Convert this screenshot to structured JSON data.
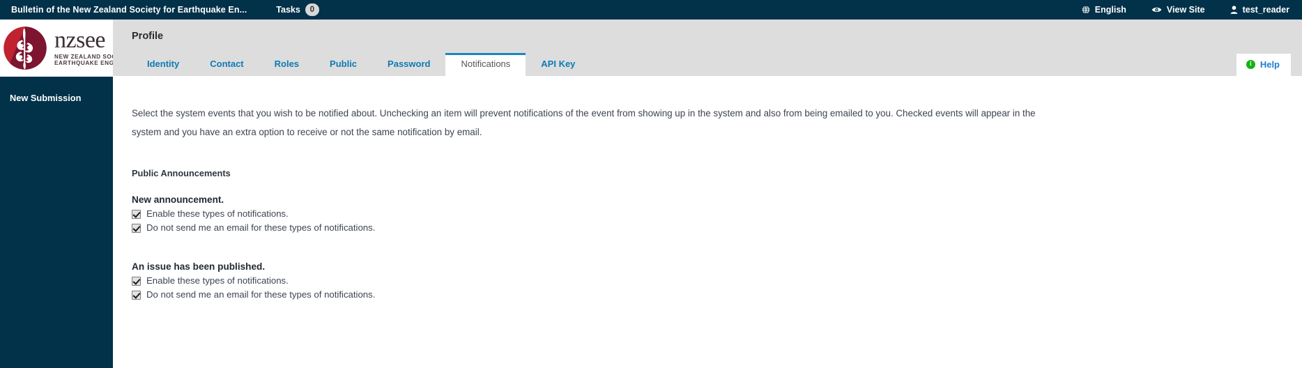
{
  "topbar": {
    "brand_title": "Bulletin of the New Zealand Society for Earthquake En...",
    "tasks_label": "Tasks",
    "tasks_count": "0",
    "language": "English",
    "language_icon": "globe-icon",
    "view_site": "View Site",
    "view_site_icon": "eye-icon",
    "user": "test_reader",
    "user_icon": "user-icon",
    "background_color": "#02314a"
  },
  "sidebar": {
    "logo": {
      "wordmark": "nzsee",
      "subline1": "NEW ZEALAND SOCIETY FOR",
      "subline2": "EARTHQUAKE ENGINEERING",
      "mark_icon": "nzsee-koru-logo-icon",
      "mark_color_light": "#c0222f",
      "mark_color_dark": "#7d1430"
    },
    "items": [
      {
        "label": "New Submission",
        "name": "sidebar-item-new-submission"
      }
    ]
  },
  "header": {
    "title": "Profile"
  },
  "tabs": [
    {
      "label": "Identity",
      "name": "tab-identity",
      "active": false
    },
    {
      "label": "Contact",
      "name": "tab-contact",
      "active": false
    },
    {
      "label": "Roles",
      "name": "tab-roles",
      "active": false
    },
    {
      "label": "Public",
      "name": "tab-public",
      "active": false
    },
    {
      "label": "Password",
      "name": "tab-password",
      "active": false
    },
    {
      "label": "Notifications",
      "name": "tab-notifications",
      "active": true
    },
    {
      "label": "API Key",
      "name": "tab-api-key",
      "active": false
    }
  ],
  "help": {
    "label": "Help",
    "icon": "info-icon",
    "icon_glyph": "i",
    "icon_color": "#12b312",
    "text_color": "#1d7fd4"
  },
  "content": {
    "intro": "Select the system events that you wish to be notified about. Unchecking an item will prevent notifications of the event from showing up in the system and also from being emailed to you. Checked events will appear in the system and you have an extra option to receive or not the same notification by email.",
    "section_heading": "Public Announcements",
    "groups": [
      {
        "title": "New announcement.",
        "options": [
          {
            "label": "Enable these types of notifications.",
            "checked": true,
            "name": "checkbox-enable-new-announcement"
          },
          {
            "label": "Do not send me an email for these types of notifications.",
            "checked": true,
            "name": "checkbox-no-email-new-announcement"
          }
        ]
      },
      {
        "title": "An issue has been published.",
        "options": [
          {
            "label": "Enable these types of notifications.",
            "checked": true,
            "name": "checkbox-enable-issue-published"
          },
          {
            "label": "Do not send me an email for these types of notifications.",
            "checked": true,
            "name": "checkbox-no-email-issue-published"
          }
        ]
      }
    ]
  }
}
